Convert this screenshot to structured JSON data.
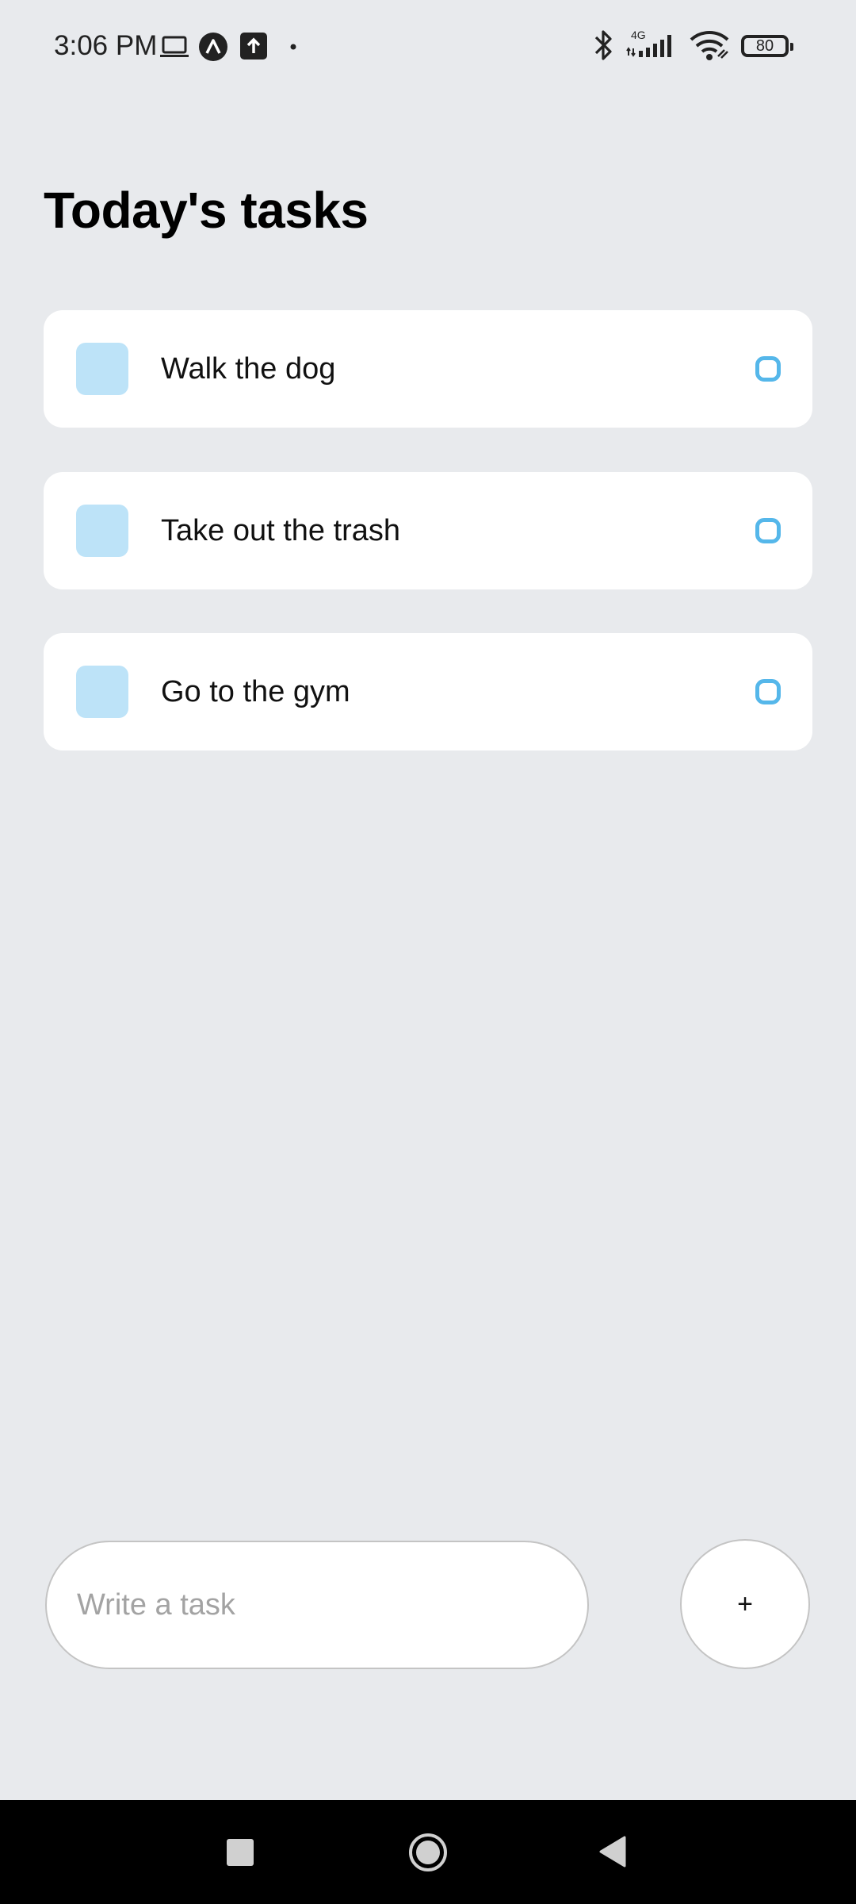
{
  "status_bar": {
    "time": "3:06 PM",
    "left_icons": [
      "laptop-icon",
      "app-a-icon",
      "upload-icon",
      "dot-icon"
    ],
    "right_icons": [
      "bluetooth-icon",
      "signal-4g-icon",
      "wifi-icon",
      "battery-icon"
    ],
    "network_label": "4G",
    "battery": "80"
  },
  "page": {
    "title": "Today's tasks"
  },
  "tasks": [
    {
      "label": "Walk the dog"
    },
    {
      "label": "Take out the trash"
    },
    {
      "label": "Go to the gym"
    }
  ],
  "composer": {
    "placeholder": "Write a task",
    "value": "",
    "add_label": "+"
  },
  "nav": {
    "buttons": [
      "recents-square-icon",
      "home-circle-icon",
      "back-triangle-icon"
    ]
  },
  "colors": {
    "background": "#e8eaed",
    "task_square": "#bde3f8",
    "task_status_accent": "#55b7ea"
  }
}
